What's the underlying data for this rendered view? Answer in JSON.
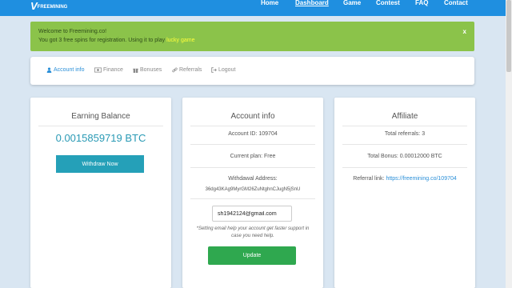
{
  "brand": {
    "mark": "V",
    "text": "FREEMINING"
  },
  "nav": {
    "home": "Home",
    "dashboard": "Dashboard",
    "game": "Game",
    "contest": "Contest",
    "faq": "FAQ",
    "contact": "Contact"
  },
  "alert": {
    "line1": "Welcome to Freemining.co!",
    "line2_prefix": "You got 3 free spins for registration. Using it to play ",
    "line2_link": "lucky game",
    "close": "x"
  },
  "tabs": {
    "account_info": "Account info",
    "finance": "Finance",
    "bonuses": "Bonuses",
    "referrals": "Referrals",
    "logout": "Logout"
  },
  "earning": {
    "title": "Earning Balance",
    "balance": "0.0015859719 BTC",
    "withdraw_label": "Withdraw Now"
  },
  "account": {
    "title": "Account info",
    "account_id": "Account ID: 109704",
    "current_plan": "Current plan: Free",
    "withdrawal_label": "Withdawal Address:",
    "withdrawal_address": "36dg43KAg9MyrGM26ZuNtghnCJugN5jSnU",
    "email_value": "sh1942124@gmail.com",
    "note_line1": "*Setting email help your account get faster support in",
    "note_line2": "case you need help.",
    "update_label": "Update"
  },
  "affiliate": {
    "title": "Affiliate",
    "total_referrals": "Total referrals: 3",
    "total_bonus": "Total Bonus: 0.00012000 BTC",
    "referral_prefix": "Referral link: ",
    "referral_url": "https://freemining.co/109704"
  },
  "colors": {
    "navbar": "#1f8fe0",
    "alert": "#8bc34a",
    "accent": "#2a8fd8",
    "balance": "#2a9ab5",
    "withdraw_button": "#25a0b8",
    "update_button": "#2fa84f"
  },
  "icons": {
    "account_info": "user-icon",
    "finance": "money-icon",
    "bonuses": "gift-icon",
    "referrals": "link-icon",
    "logout": "sign-out-icon"
  }
}
